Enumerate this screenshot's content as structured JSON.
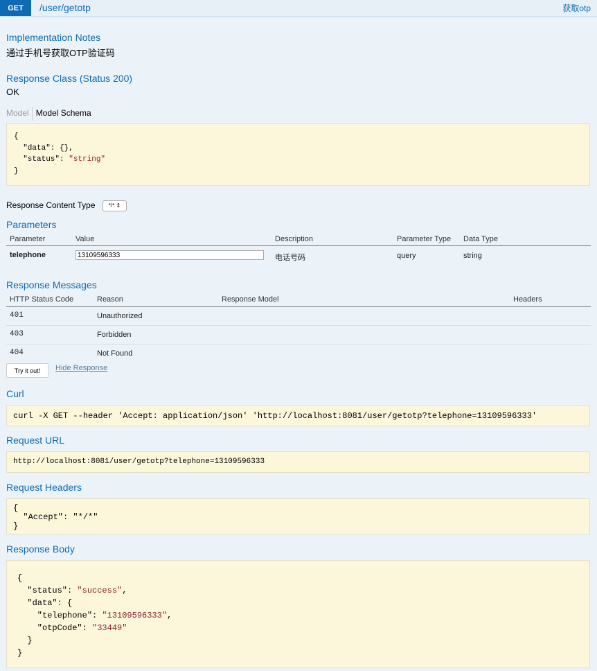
{
  "header": {
    "method": "GET",
    "path": "/user/getotp",
    "summary": "获取otp"
  },
  "implementation_notes": {
    "title": "Implementation Notes",
    "text": "通过手机号获取OTP验证码"
  },
  "response_class": {
    "title": "Response Class (Status 200)",
    "text": "OK"
  },
  "model_tabs": {
    "model": "Model",
    "schema": "Model Schema"
  },
  "schema_lines": [
    "{",
    "  \"data\": {},",
    "  \"status\": ",
    "\"string\"",
    "}"
  ],
  "response_content_type": {
    "label": "Response Content Type",
    "selected": "*/*"
  },
  "parameters": {
    "title": "Parameters",
    "headers": [
      "Parameter",
      "Value",
      "Description",
      "Parameter Type",
      "Data Type"
    ],
    "rows": [
      {
        "name": "telephone",
        "value": "13109596333",
        "description": "电话号码",
        "param_type": "query",
        "data_type": "string"
      }
    ]
  },
  "response_messages": {
    "title": "Response Messages",
    "headers": [
      "HTTP Status Code",
      "Reason",
      "Response Model",
      "Headers"
    ],
    "rows": [
      {
        "code": "401",
        "reason": "Unauthorized"
      },
      {
        "code": "403",
        "reason": "Forbidden"
      },
      {
        "code": "404",
        "reason": "Not Found"
      }
    ]
  },
  "actions": {
    "try_it_out": "Try it out!",
    "hide_response": "Hide Response"
  },
  "curl": {
    "title": "Curl",
    "command": "curl -X GET --header 'Accept: application/json' 'http://localhost:8081/user/getotp?telephone=13109596333'"
  },
  "request_url": {
    "title": "Request URL",
    "url": "http://localhost:8081/user/getotp?telephone=13109596333"
  },
  "request_headers": {
    "title": "Request Headers",
    "open": "{",
    "key": "  \"Accept\": ",
    "value": "\"*/*\"",
    "close": "}"
  },
  "response_body": {
    "title": "Response Body",
    "l1": "{",
    "l2_key": "  \"status\": ",
    "l2_val": "\"success\"",
    "l2_end": ",",
    "l3": "  \"data\": {",
    "l4_key": "    \"telephone\": ",
    "l4_val": "\"13109596333\"",
    "l4_end": ",",
    "l5_key": "    \"otpCode\": ",
    "l5_val": "\"33449\"",
    "l6": "  }",
    "l7": "}"
  }
}
